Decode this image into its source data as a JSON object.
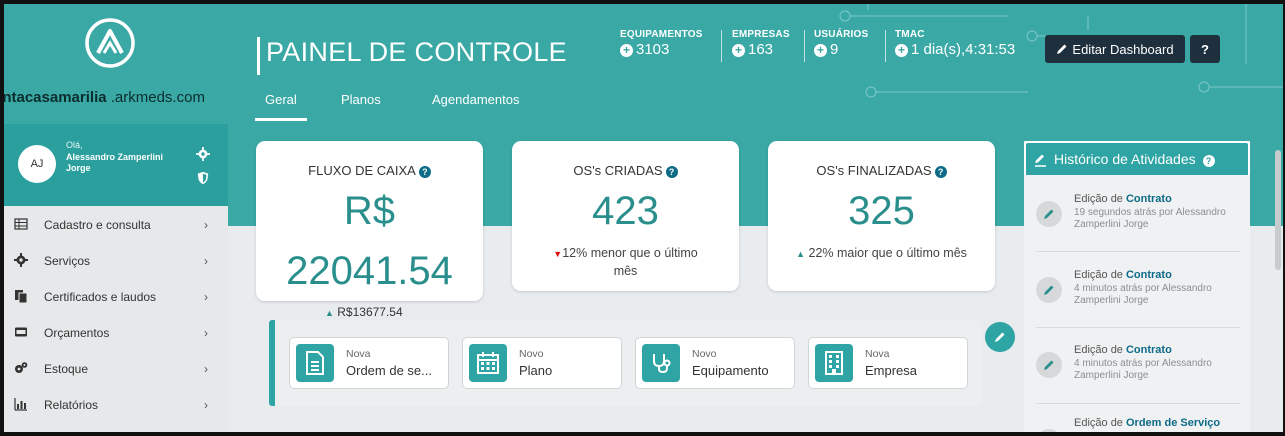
{
  "sidebar": {
    "host_bold": "antacasamarilia",
    "host_rest": " .arkmeds.com",
    "user": {
      "initials": "AJ",
      "greeting": "Olá,",
      "name": "Alessandro Zamperlini Jorge"
    },
    "items": [
      {
        "label": "Cadastro e consulta",
        "icon": "table-icon"
      },
      {
        "label": "Serviços",
        "icon": "gear-icon"
      },
      {
        "label": "Certificados e laudos",
        "icon": "copy-icon"
      },
      {
        "label": "Orçamentos",
        "icon": "card-icon"
      },
      {
        "label": "Estoque",
        "icon": "cogs-icon"
      },
      {
        "label": "Relatórios",
        "icon": "bar-chart-icon"
      }
    ]
  },
  "header": {
    "title": "PAINEL DE CONTROLE",
    "stats": [
      {
        "label": "EQUIPAMENTOS",
        "value": "3103"
      },
      {
        "label": "EMPRESAS",
        "value": "163"
      },
      {
        "label": "USUÁRIOS",
        "value": "9"
      },
      {
        "label": "TMAC",
        "value": "1 dia(s),4:31:53"
      }
    ],
    "edit_button": "Editar Dashboard",
    "help_button": "?",
    "tabs": [
      "Geral",
      "Planos",
      "Agendamentos"
    ]
  },
  "cards": {
    "fluxo": {
      "title": "FLUXO DE CAIXA",
      "currency": "R$",
      "value": "22041.54",
      "delta": "R$13677.54"
    },
    "criadas": {
      "title": "OS's CRIADAS",
      "value": "423",
      "compare_line1": "12% menor que o último",
      "compare_line2": "mês"
    },
    "finalizadas": {
      "title": "OS's FINALIZADAS",
      "value": "325",
      "compare": "22% maior que o último mês"
    }
  },
  "quick_actions": [
    {
      "small": "Nova",
      "main": "Ordem de se...",
      "icon": "document-icon"
    },
    {
      "small": "Novo",
      "main": "Plano",
      "icon": "calendar-icon"
    },
    {
      "small": "Novo",
      "main": "Equipamento",
      "icon": "stethoscope-icon"
    },
    {
      "small": "Nova",
      "main": "Empresa",
      "icon": "building-icon"
    }
  ],
  "activity": {
    "title": "Histórico de Atividades",
    "items": [
      {
        "prefix": "Edição de ",
        "object": "Contrato",
        "meta": "19 segundos atrás por Alessandro Zamperlini Jorge"
      },
      {
        "prefix": "Edição de ",
        "object": "Contrato",
        "meta": "4 minutos atrás por Alessandro Zamperlini Jorge"
      },
      {
        "prefix": "Edição de ",
        "object": "Contrato",
        "meta": "4 minutos atrás por Alessandro Zamperlini Jorge"
      },
      {
        "prefix": "Edição de ",
        "object": "Ordem de Serviço",
        "meta": ""
      }
    ]
  },
  "colors": {
    "teal": "#3aa9a6",
    "dark": "#1e2f3d",
    "accent_text": "#2a8f8c"
  }
}
